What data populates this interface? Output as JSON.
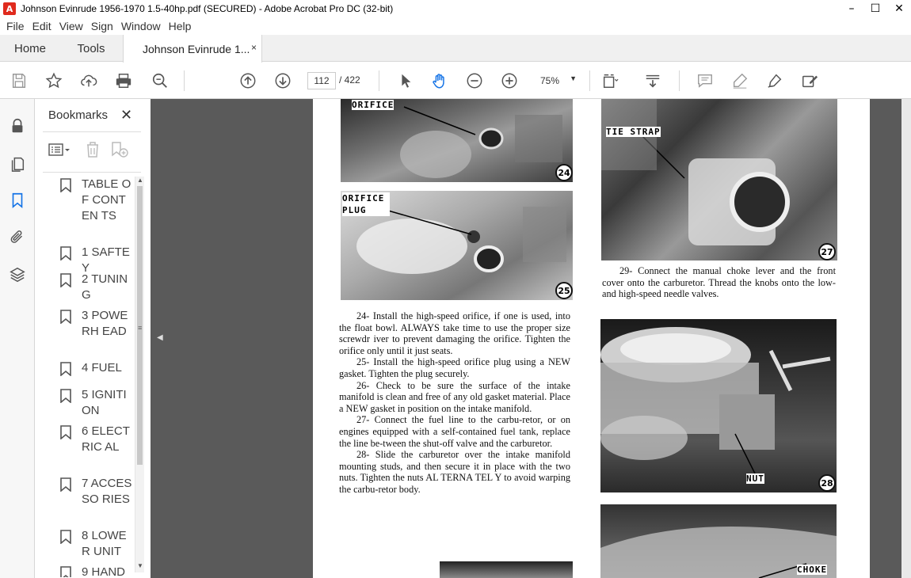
{
  "window": {
    "title": "Johnson Evinrude 1956-1970 1.5-40hp.pdf (SECURED) - Adobe Acrobat Pro DC (32-bit)",
    "app_icon": "acrobat-icon",
    "controls": [
      "minimize-icon",
      "maximize-icon",
      "close-icon"
    ],
    "minimize": "–",
    "maximize": "☐",
    "close": "✕"
  },
  "menu": [
    "File",
    "Edit",
    "View",
    "Sign",
    "Window",
    "Help"
  ],
  "tabs": {
    "home": "Home",
    "tools": "Tools",
    "document": "Johnson Evinrude 1...",
    "close": "×"
  },
  "toolbar": {
    "icons": [
      "save-icon",
      "bookmark-star-icon",
      "upload-icon",
      "print-icon",
      "search-zoom-icon",
      "prev-page-icon",
      "next-page-icon",
      "select-arrow-icon",
      "hand-icon",
      "zoom-out-icon",
      "zoom-in-icon",
      "fit-page-icon",
      "scroll-mode-icon",
      "comment-icon",
      "highlight-icon",
      "sign-icon",
      "fill-sign-icon"
    ],
    "current_page": "112",
    "total_pages": "/ 422",
    "zoom": "75%"
  },
  "left_rail": {
    "icons": [
      "lock-icon",
      "page-thumbnails-icon",
      "bookmarks-icon",
      "attachments-icon",
      "layers-icon"
    ]
  },
  "bookmarks": {
    "title": "Bookmarks",
    "close": "✕",
    "items": [
      {
        "label": "TABLE OF CONTEN TS"
      },
      {
        "label": "1 SAFTEY"
      },
      {
        "label": "2 TUNING"
      },
      {
        "label": "3 POWERH EAD"
      },
      {
        "label": "4 FUEL"
      },
      {
        "label": "5 IGNITION"
      },
      {
        "label": "6 ELECTRIC AL"
      },
      {
        "label": "7 ACCESSO RIES"
      },
      {
        "label": "8 LOWER UNIT"
      },
      {
        "label": "9 HAND"
      }
    ]
  },
  "document": {
    "figures": [
      {
        "num": "24",
        "label": "ORIFICE"
      },
      {
        "num": "25",
        "label": "ORIFICE PLUG"
      },
      {
        "num": "27",
        "label": "TIE STRAP"
      },
      {
        "num": "28",
        "label": "NUT"
      },
      {
        "num": "",
        "label": "CHOKE"
      }
    ],
    "left_column": [
      "24- Install the high-speed orifice, if one is used, into the float bowl. ALWAYS take time to use the proper size screwdr iver to prevent damaging the orifice. Tighten the orifice only until it just seats.",
      "25- Install the high-speed orifice plug using a NEW gasket. Tighten the plug securely.",
      "26- Check to be sure the surface of the intake manifold is clean and free of any old gasket material. Place a NEW gasket in position on the intake manifold.",
      "27- Connect the fuel line to the carbu-retor, or on engines equipped with a self-contained fuel tank, replace the line be-tween the shut-off valve and the carburetor.",
      "28- Slide the carburetor over the intake manifold mounting studs, and then secure it in place with the two nuts. Tighten the nuts AL TERNA TEL Y to avoid warping the carbu-retor body."
    ],
    "right_column": [
      "29- Connect the manual choke lever and the front cover onto the carburetor. Thread the knobs onto the low- and high-speed needle valves."
    ]
  }
}
